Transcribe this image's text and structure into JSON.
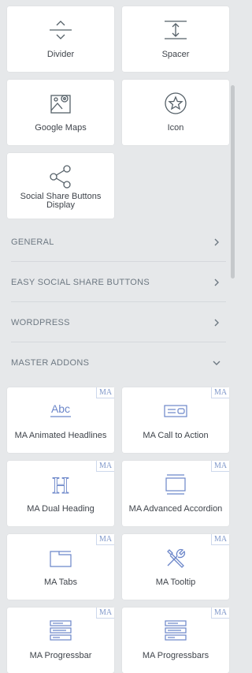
{
  "widgets_top": [
    {
      "label": "Divider",
      "icon": "divider-icon"
    },
    {
      "label": "Spacer",
      "icon": "spacer-icon"
    },
    {
      "label": "Google Maps",
      "icon": "google-maps-icon"
    },
    {
      "label": "Icon",
      "icon": "star-circle-icon"
    },
    {
      "label": "Social Share Buttons Display",
      "icon": "share-icon"
    }
  ],
  "sections": [
    {
      "title": "GENERAL",
      "state": "collapsed"
    },
    {
      "title": "EASY SOCIAL SHARE BUTTONS",
      "state": "collapsed"
    },
    {
      "title": "WORDPRESS",
      "state": "collapsed"
    },
    {
      "title": "MASTER ADDONS",
      "state": "expanded"
    }
  ],
  "master_addons": {
    "badge": "MA",
    "items": [
      {
        "label": "MA Animated Headlines",
        "icon": "abc-text-icon"
      },
      {
        "label": "MA Call to Action",
        "icon": "call-to-action-icon"
      },
      {
        "label": "MA Dual Heading",
        "icon": "heading-h-icon"
      },
      {
        "label": "MA Advanced Accordion",
        "icon": "accordion-icon"
      },
      {
        "label": "MA Tabs",
        "icon": "tabs-icon"
      },
      {
        "label": "MA Tooltip",
        "icon": "tools-icon"
      },
      {
        "label": "MA Progressbar",
        "icon": "progressbar-icon"
      },
      {
        "label": "MA Progressbars",
        "icon": "progressbars-icon"
      }
    ]
  },
  "colors": {
    "panel_bg": "#e6e8ea",
    "card_bg": "#ffffff",
    "icon": "#556068",
    "ma_accent": "#6b86c9"
  }
}
